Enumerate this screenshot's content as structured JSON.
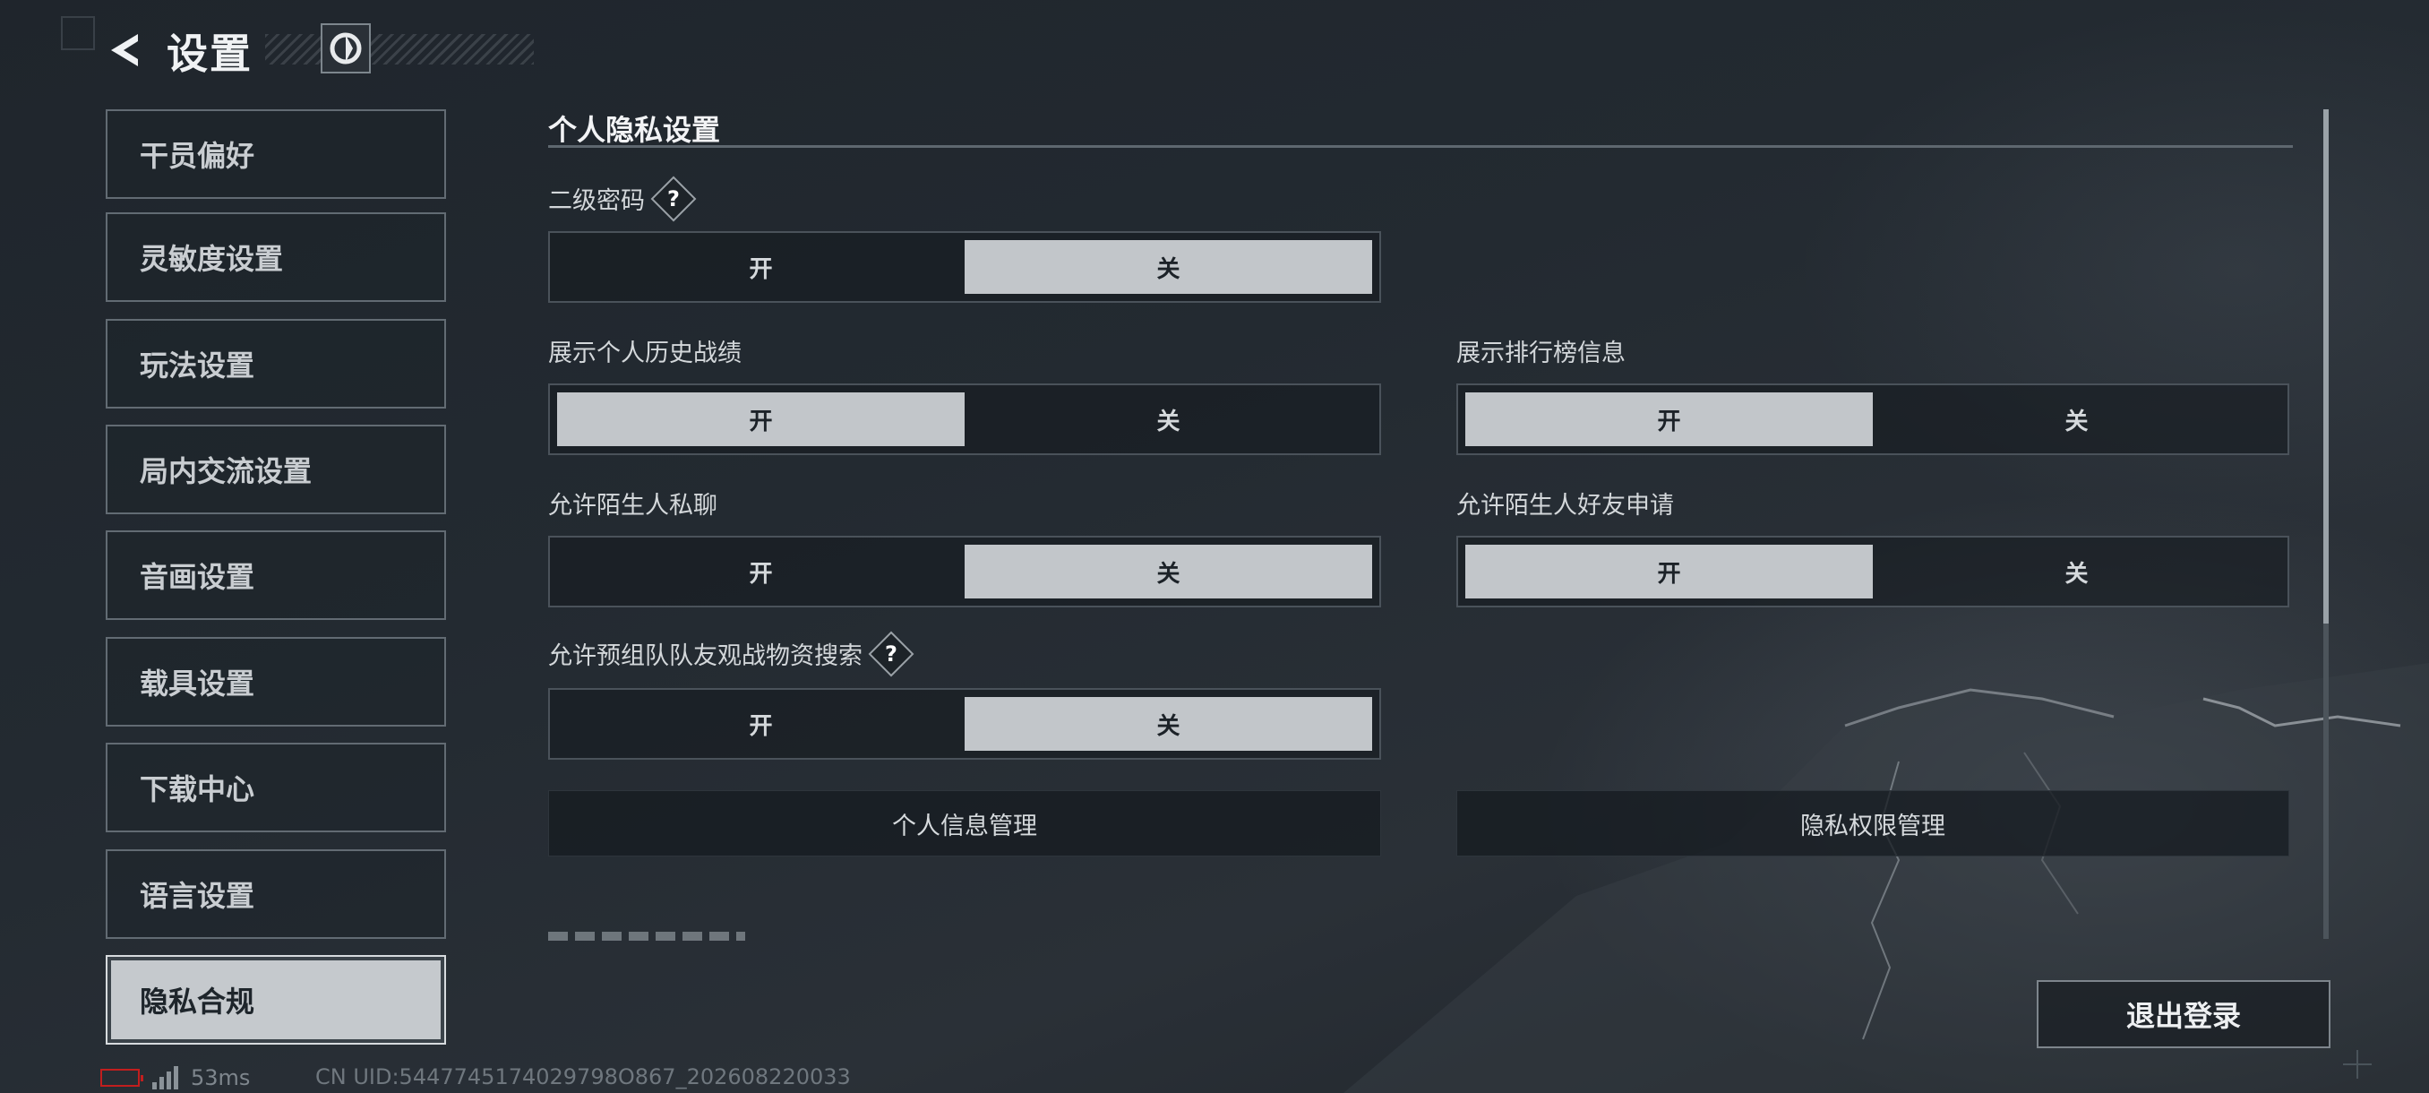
{
  "header": {
    "title": "设置",
    "back_icon": "back-arrow-icon",
    "logo_icon": "game-logo-icon"
  },
  "sidebar": {
    "items": [
      {
        "label": "干员偏好"
      },
      {
        "label": "灵敏度设置"
      },
      {
        "label": "玩法设置"
      },
      {
        "label": "局内交流设置"
      },
      {
        "label": "音画设置"
      },
      {
        "label": "载具设置"
      },
      {
        "label": "下载中心"
      },
      {
        "label": "语言设置"
      },
      {
        "label": "隐私合规",
        "active": true
      }
    ]
  },
  "content": {
    "section_title": "个人隐私设置",
    "settings": [
      {
        "label": "二级密码",
        "help": "?",
        "on": "开",
        "off": "关",
        "value": "关"
      },
      {
        "label": "展示个人历史战绩",
        "on": "开",
        "off": "关",
        "value": "开"
      },
      {
        "label": "展示排行榜信息",
        "on": "开",
        "off": "关",
        "value": "开"
      },
      {
        "label": "允许陌生人私聊",
        "on": "开",
        "off": "关",
        "value": "关"
      },
      {
        "label": "允许陌生人好友申请",
        "on": "开",
        "off": "关",
        "value": "开"
      },
      {
        "label": "允许预组队队友观战物资搜索",
        "help": "?",
        "on": "开",
        "off": "关",
        "value": "关"
      }
    ],
    "buttons": {
      "personal_info": "个人信息管理",
      "privacy_permissions": "隐私权限管理"
    }
  },
  "logout": {
    "label": "退出登录"
  },
  "status": {
    "ping": "53ms",
    "uid": "CN UID:5447745174029798O867_202608220033"
  },
  "colors": {
    "selected_option": "#c2c6ca",
    "battery_low": "#c21e1e"
  }
}
